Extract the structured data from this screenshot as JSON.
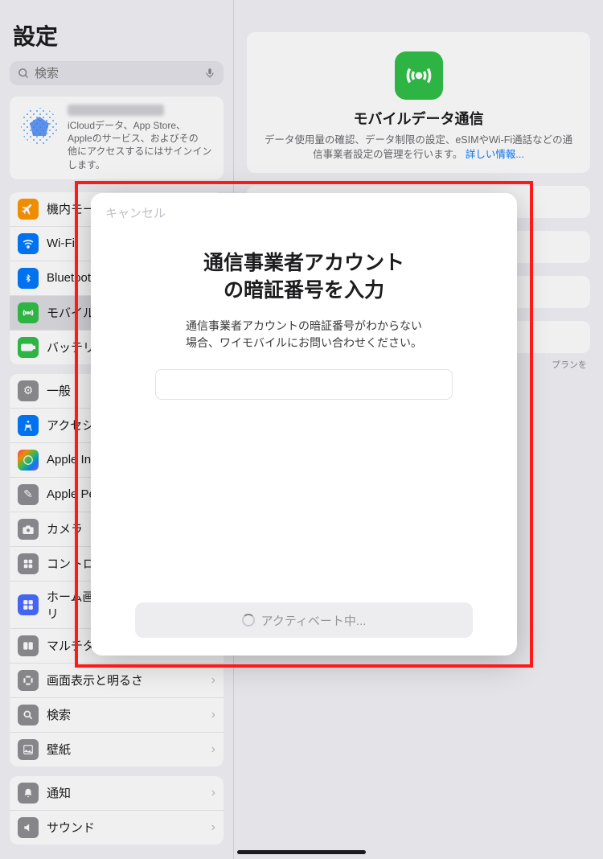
{
  "settings_title": "設定",
  "search": {
    "placeholder": "検索"
  },
  "apple_id": {
    "line1": "iCloudデータ、App Store、",
    "line2": "Appleのサービス、およびその",
    "line3": "他にアクセスするにはサインイン",
    "line4": "します。"
  },
  "menu_group1": [
    {
      "label": "機内モード",
      "icon": "airplane",
      "color": "#ff9500"
    },
    {
      "label": "Wi-Fi",
      "icon": "wifi",
      "color": "#007aff"
    },
    {
      "label": "Bluetooth",
      "icon": "bluetooth",
      "color": "#007aff"
    },
    {
      "label": "モバイルデータ通信",
      "icon": "antenna",
      "color": "#30c048",
      "selected": true
    },
    {
      "label": "バッテリー",
      "icon": "battery",
      "color": "#30c048"
    }
  ],
  "menu_group2": [
    {
      "label": "一般",
      "icon": "gear",
      "color": "#8e8e93"
    },
    {
      "label": "アクセシビリティ",
      "icon": "access",
      "color": "#007aff"
    },
    {
      "label": "Apple Intelligence",
      "icon": "ai",
      "color": "#multicolor"
    },
    {
      "label": "Apple Pencil",
      "icon": "pencil",
      "color": "#8e8e93"
    },
    {
      "label": "カメラ",
      "icon": "camera",
      "color": "#8e8e93"
    },
    {
      "label": "コントロールセンター",
      "icon": "control",
      "color": "#8e8e93"
    },
    {
      "label": "ホーム画面とアプリライブラリ",
      "icon": "home",
      "color": "#4a6cff"
    },
    {
      "label": "マルチタスクとジェスチャ",
      "icon": "multitask",
      "color": "#8e8e93"
    },
    {
      "label": "画面表示と明るさ",
      "icon": "display",
      "color": "#8e8e93"
    },
    {
      "label": "検索",
      "icon": "search",
      "color": "#8e8e93"
    },
    {
      "label": "壁紙",
      "icon": "wallpaper",
      "color": "#8e8e93"
    }
  ],
  "menu_group3": [
    {
      "label": "通知",
      "icon": "bell",
      "color": "#8e8e93"
    },
    {
      "label": "サウンド",
      "icon": "sound",
      "color": "#8e8e93"
    }
  ],
  "right": {
    "title": "モバイルデータ通信",
    "subtitle_a": "データ使用量の確認、データ制限の設定、eSIMやWi-Fi通話などの通信事業者設定の管理を行います。",
    "more_link": "詳しい情報...",
    "hint_fragment": "プランを"
  },
  "modal": {
    "cancel": "キャンセル",
    "title_l1": "通信事業者アカウント",
    "title_l2": "の暗証番号を入力",
    "sub_l1": "通信事業者アカウントの暗証番号がわからない",
    "sub_l2": "場合、ワイモバイルにお問い合わせください。",
    "button": "アクティベート中..."
  }
}
